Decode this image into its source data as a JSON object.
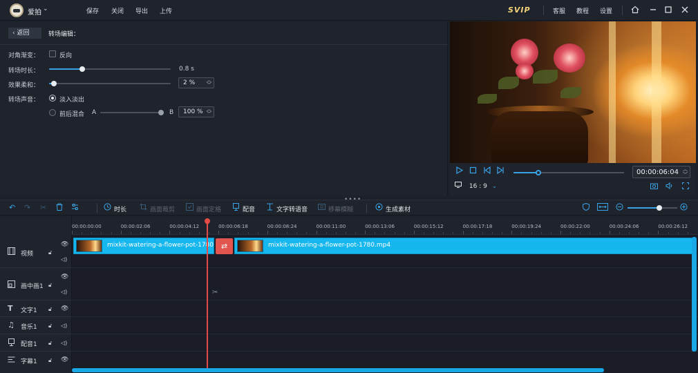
{
  "app": {
    "name": "爱拍",
    "caret": "⌄"
  },
  "menu": {
    "save": "保存",
    "close": "关闭",
    "export": "导出",
    "upload": "上传"
  },
  "top_right": {
    "svip": "SVIP",
    "support": "客服",
    "tutorial": "教程",
    "settings": "设置"
  },
  "editor": {
    "back_label": "返回",
    "title": "转场编辑：",
    "diagonal_label": "对角渐变：",
    "reverse_label": "反向",
    "duration_label": "转场时长：",
    "duration_value": "0.8 s",
    "softness_label": "效果柔和：",
    "softness_value": "2 %",
    "audio_label": "转场声音：",
    "audio_fade": "淡入淡出",
    "audio_mix": "前后混合",
    "mix_a": "A",
    "mix_b": "B",
    "mix_value": "100 %"
  },
  "player": {
    "timecode": "00:00:06:04",
    "ratio": "16 : 9"
  },
  "toolbar": {
    "duration": "时长",
    "crop": "画面裁剪",
    "freeze": "画面定格",
    "dub": "配音",
    "tts": "文字转语音",
    "blur": "移幕模糊",
    "generate": "生成素材"
  },
  "ruler": [
    "00:00:00:00",
    "00:00:02:06",
    "00:00:04:12",
    "00:00:06:18",
    "00:00:08:24",
    "00:00:11:00",
    "00:00:13:06",
    "00:00:15:12",
    "00:00:17:18",
    "00:00:19:24",
    "00:00:22:00",
    "00:00:24:06",
    "00:00:26:12"
  ],
  "tracks": [
    {
      "label": "视频"
    },
    {
      "label": "画中画1"
    },
    {
      "label": "文字1"
    },
    {
      "label": "音乐1"
    },
    {
      "label": "配音1"
    },
    {
      "label": "字幕1"
    }
  ],
  "clips": {
    "first": "mixkit-watering-a-flower-pot-1780.m...",
    "second": "mixkit-watering-a-flower-pot-1780.mp4"
  },
  "colors": {
    "accent": "#3aa4e8",
    "clip": "#16b6ef",
    "playhead": "#e24b47",
    "svip": "#f3d37a"
  }
}
